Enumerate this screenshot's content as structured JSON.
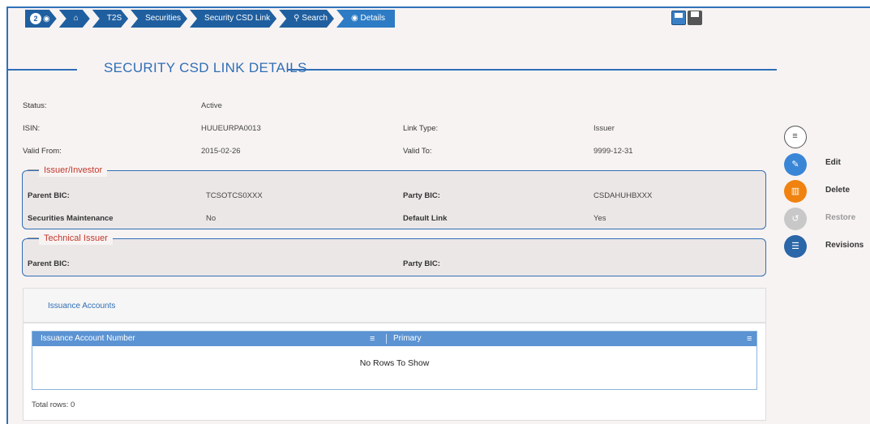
{
  "breadcrumb": {
    "badge_count": "2",
    "items": [
      "T2S",
      "Securities",
      "Security CSD Link",
      "Search",
      "Details"
    ]
  },
  "page": {
    "title": "SECURITY CSD LINK DETAILS"
  },
  "details": {
    "status_label": "Status:",
    "status_value": "Active",
    "isin_label": "ISIN:",
    "isin_value": "HUUEURPA0013",
    "link_type_label": "Link Type:",
    "link_type_value": "Issuer",
    "valid_from_label": "Valid From:",
    "valid_from_value": "2015-02-26",
    "valid_to_label": "Valid To:",
    "valid_to_value": "9999-12-31"
  },
  "issuer_investor": {
    "legend": "Issuer/Investor",
    "parent_bic_label": "Parent BIC:",
    "parent_bic_value": "TCSOTCS0XXX",
    "party_bic_label": "Party BIC:",
    "party_bic_value": "CSDAHUHBXXX",
    "sec_maint_label": "Securities Maintenance",
    "sec_maint_value": "No",
    "default_link_label": "Default Link",
    "default_link_value": "Yes"
  },
  "technical_issuer": {
    "legend": "Technical Issuer",
    "parent_bic_label": "Parent BIC:",
    "party_bic_label": "Party BIC:"
  },
  "actions": {
    "edit": "Edit",
    "delete": "Delete",
    "restore": "Restore",
    "revisions": "Revisions"
  },
  "issuance_accounts": {
    "tab_label": "Issuance Accounts",
    "columns": [
      "Issuance Account Number",
      "Primary"
    ],
    "empty_text": "No Rows To Show",
    "total_rows": "Total rows: 0"
  },
  "colors": {
    "primary": "#2f6fb5",
    "edit": "#3a86d6",
    "delete": "#f0820f",
    "restore": "#c8c8c8",
    "revisions": "#2a66a8",
    "legend_red": "#c0392b"
  }
}
